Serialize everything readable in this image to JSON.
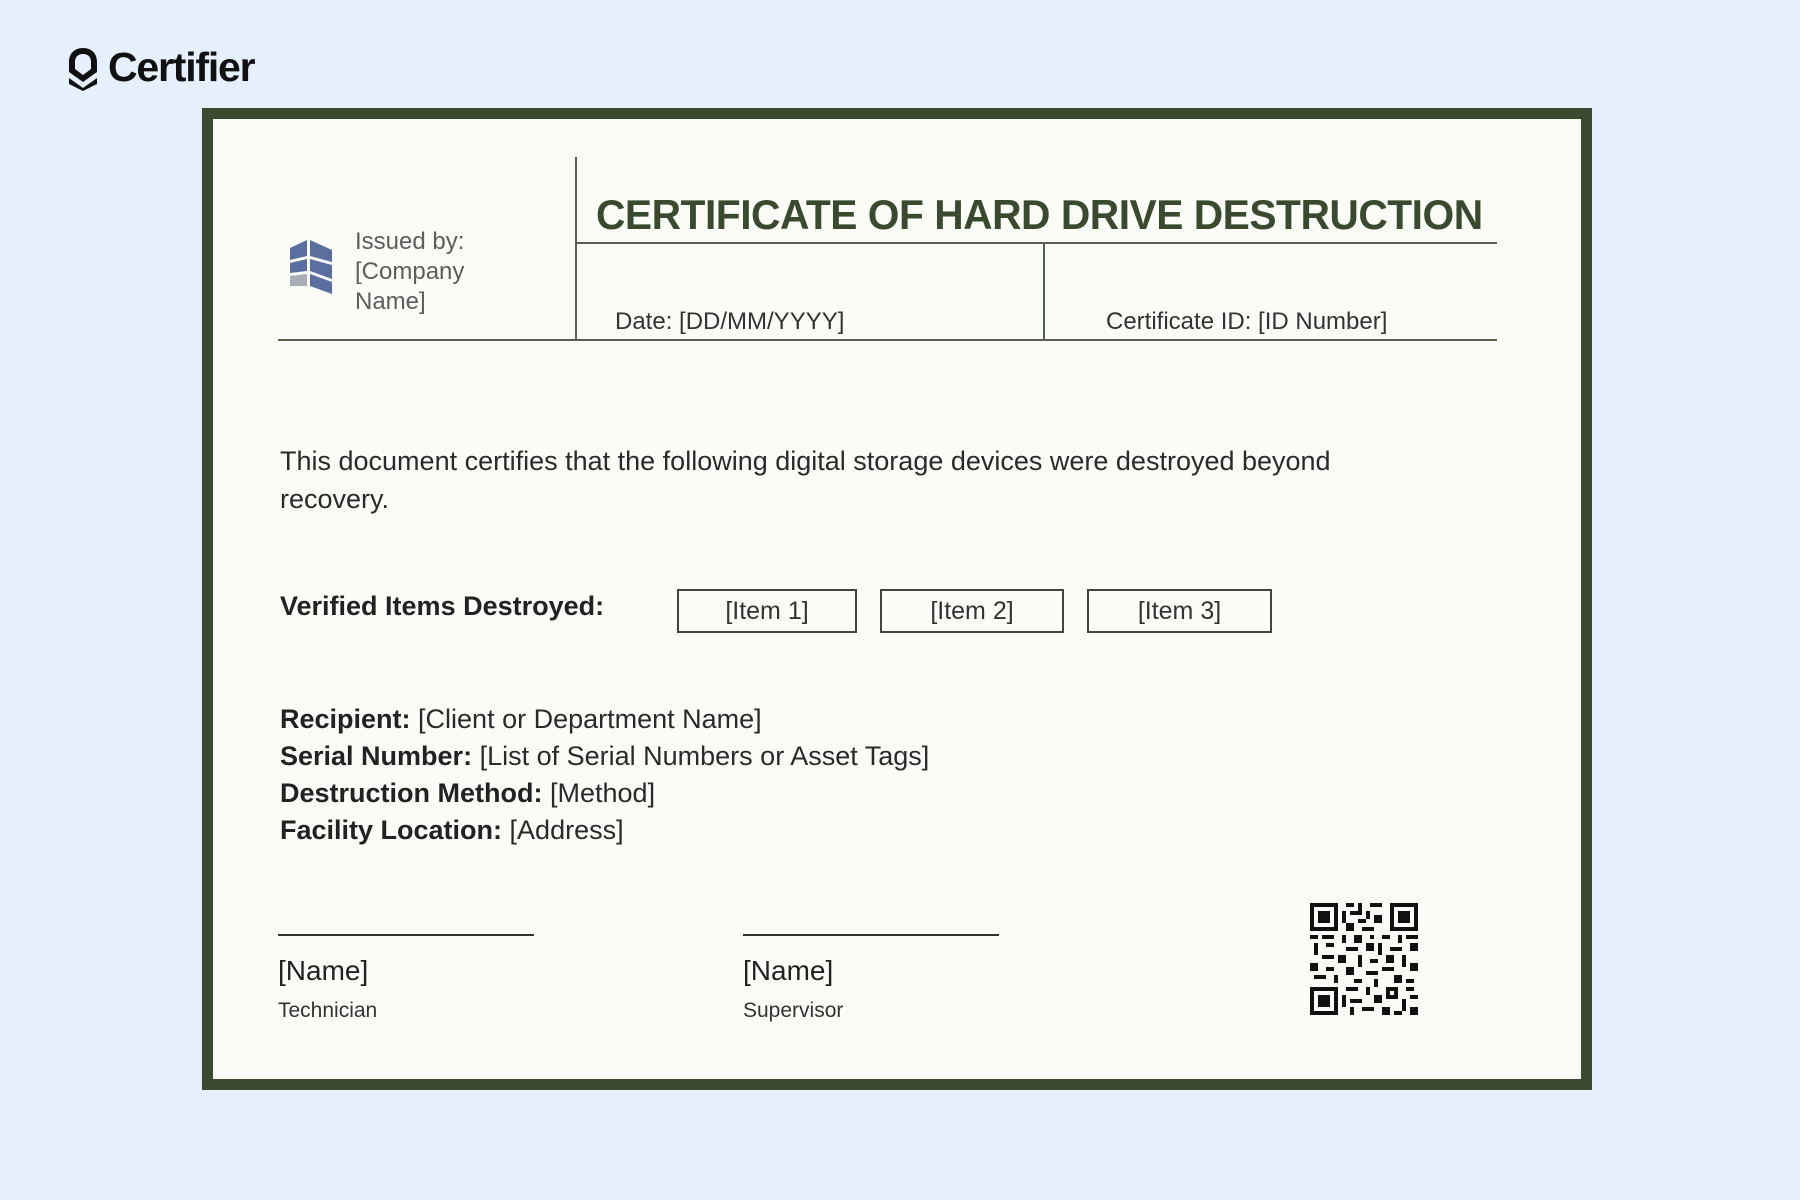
{
  "brand": {
    "name": "Certifier",
    "icon": "certifier-shield-icon"
  },
  "certificate": {
    "issued_by": "Issued by: [Company Name]",
    "issuer_logo": "company-blocks-icon",
    "title": "CERTIFICATE OF HARD DRIVE DESTRUCTION",
    "date": "Date: [DD/MM/YYYY]",
    "certificate_id": "Certificate ID: [ID Number]",
    "statement": "This document certifies that the following digital storage devices were destroyed beyond recovery.",
    "items_label": "Verified Items Destroyed:",
    "items": [
      "[Item 1]",
      "[Item 2]",
      "[Item 3]"
    ],
    "details": [
      {
        "label": "Recipient:",
        "value": "[Client or Department Name]"
      },
      {
        "label": "Serial Number:",
        "value": "[List of Serial Numbers or Asset Tags]"
      },
      {
        "label": "Destruction Method:",
        "value": "[Method]"
      },
      {
        "label": "Facility Location:",
        "value": "[Address]"
      }
    ],
    "signatures": [
      {
        "name": "[Name]",
        "role": "Technician"
      },
      {
        "name": "[Name]",
        "role": "Supervisor"
      }
    ],
    "qr_icon": "qr-code-icon"
  },
  "colors": {
    "background": "#e6f0fc",
    "frame": "#3a4a2f",
    "paper": "#fbfbf8",
    "title": "#3a4a2f",
    "logo_blue": "#5a6fa0",
    "logo_gray": "#a9adb5"
  }
}
